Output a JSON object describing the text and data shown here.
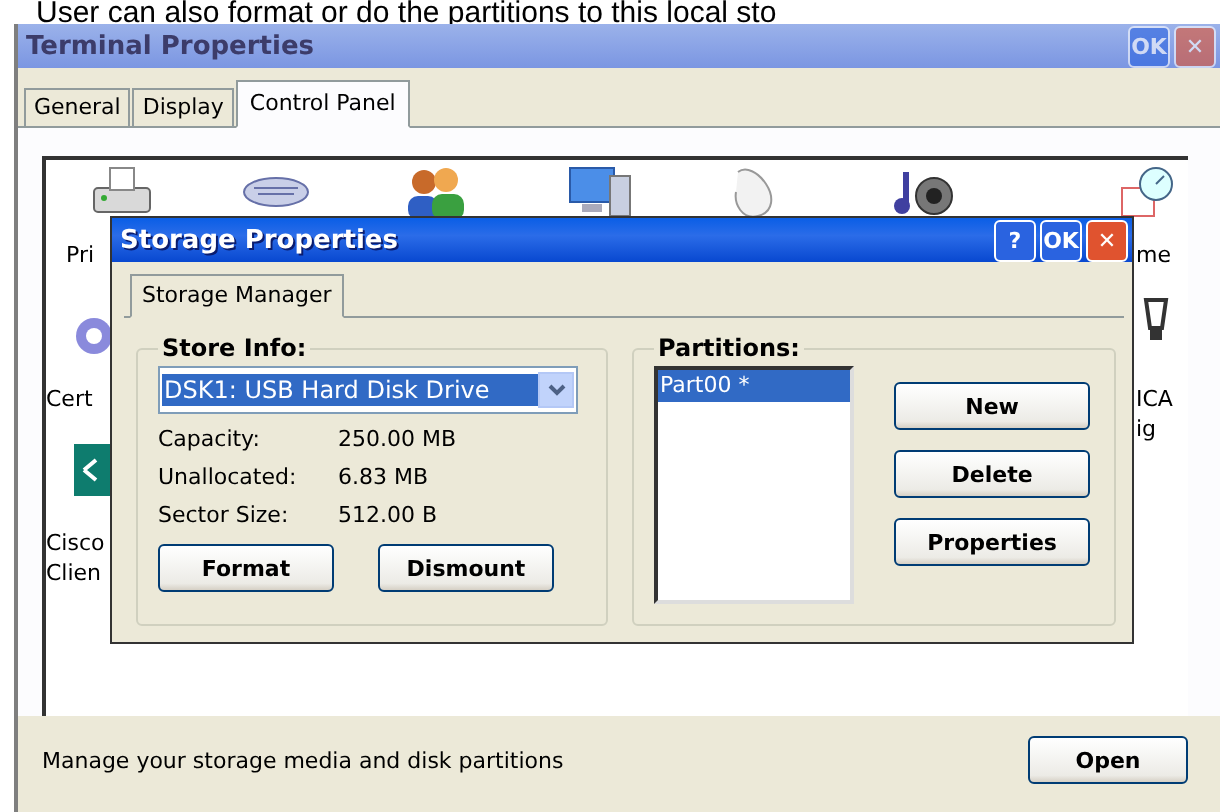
{
  "caption": "User can also format or do the partitions to this local sto",
  "window": {
    "title": "Terminal Properties",
    "buttons": [
      {
        "kind": "ok",
        "label": "OK"
      },
      {
        "kind": "close",
        "label": "✕"
      }
    ]
  },
  "tabs": [
    {
      "label": "General",
      "selected": false
    },
    {
      "label": "Display",
      "selected": false
    },
    {
      "label": "Control Panel",
      "selected": true
    }
  ],
  "control_panel_labels": [
    "Pri",
    "me",
    "Cert",
    "ICA\nig",
    "Cisco\nClien"
  ],
  "dialog": {
    "title": "Storage Properties",
    "buttons": [
      {
        "kind": "help",
        "label": "?"
      },
      {
        "kind": "ok",
        "label": "OK"
      },
      {
        "kind": "close",
        "label": "✕"
      }
    ],
    "tabs": [
      {
        "label": "Storage Manager",
        "selected": true
      }
    ],
    "store_info": {
      "title": "Store Info:",
      "drive": "DSK1: USB Hard Disk Drive",
      "fields": [
        {
          "label": "Capacity:",
          "value": "250.00 MB"
        },
        {
          "label": "Unallocated:",
          "value": "6.83 MB"
        },
        {
          "label": "Sector Size:",
          "value": "512.00 B"
        }
      ],
      "buttons": [
        "Format",
        "Dismount"
      ]
    },
    "partitions": {
      "title": "Partitions:",
      "items": [
        {
          "label": "Part00 *",
          "selected": true
        }
      ],
      "buttons": [
        "New",
        "Delete",
        "Properties"
      ]
    }
  },
  "status_text": "Manage your storage media and disk partitions",
  "open_button": "Open"
}
